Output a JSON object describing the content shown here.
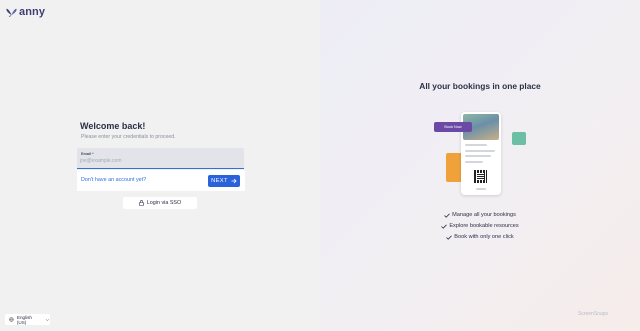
{
  "brand": {
    "name": "anny",
    "logo_icon": "butterfly-icon"
  },
  "login": {
    "title": "Welcome back!",
    "subtitle": "Please enter your credentials to proceed.",
    "email_label": "Email *",
    "email_placeholder": "joe@example.com",
    "email_value": "",
    "signup_link": "Don't have an account yet?",
    "next_label": "NEXT",
    "sso_label": "Login via SSO"
  },
  "language": {
    "selected": "English (US)"
  },
  "promo": {
    "headline": "All your bookings in one place",
    "book_now_label": "Book Now",
    "features": [
      "Manage all your bookings",
      "Explore bookable resources",
      "Book with only one click"
    ]
  },
  "watermark": "ScreenSnaps",
  "colors": {
    "accent": "#2962d9",
    "brand": "#3d3f75",
    "purple": "#6a4aa5",
    "teal": "#6dbfa4",
    "orange": "#f0a23a"
  }
}
